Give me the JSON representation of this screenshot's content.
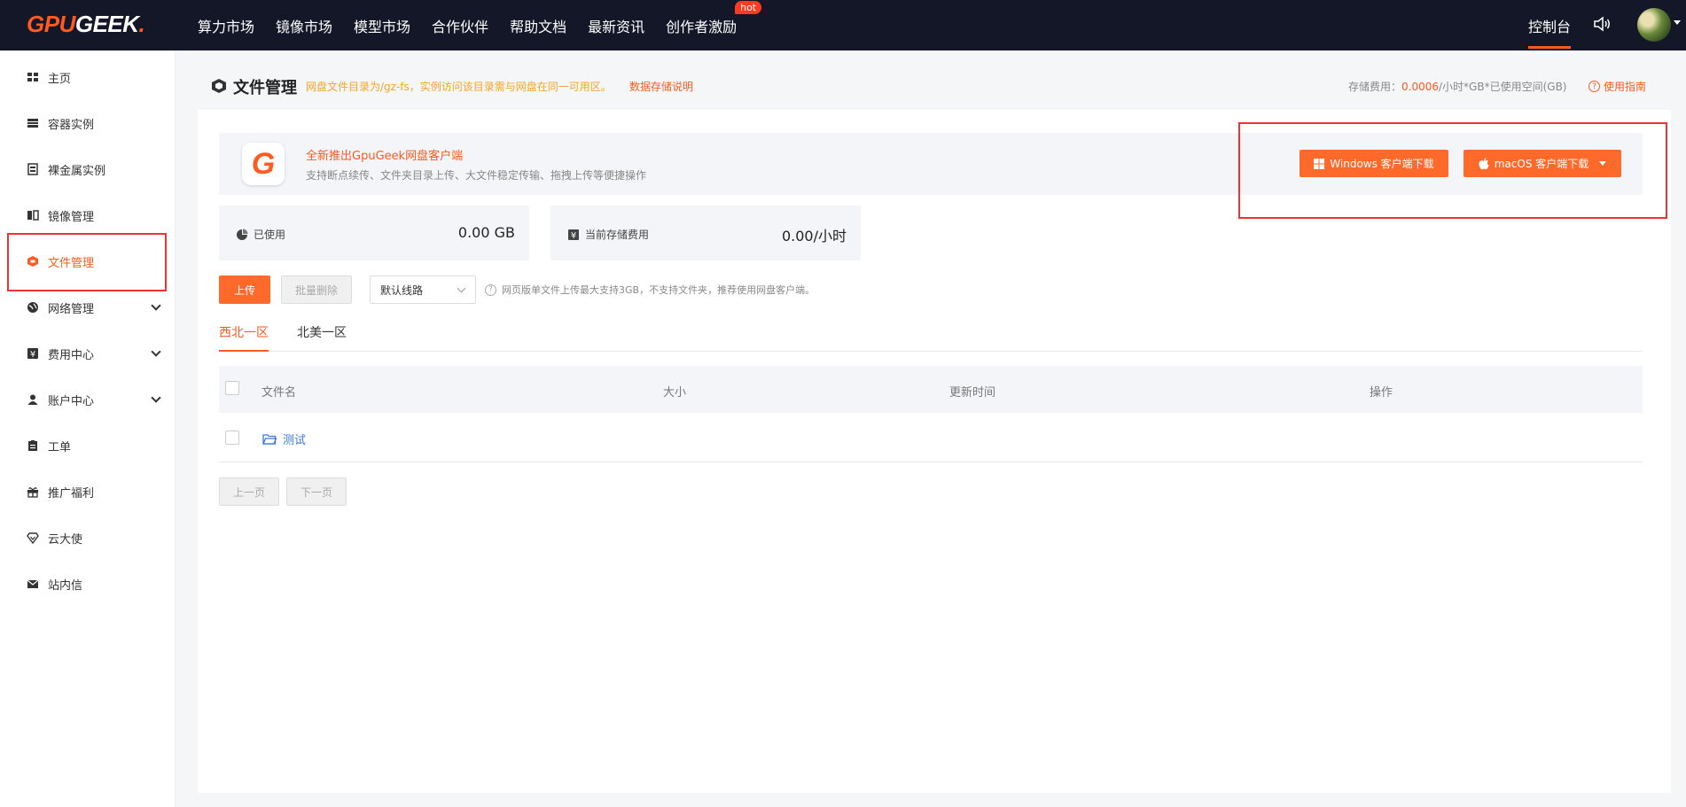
{
  "brand": {
    "part1": "GPU",
    "part2": "GEEK",
    "dot": "."
  },
  "nav": {
    "items": [
      "算力市场",
      "镜像市场",
      "模型市场",
      "合作伙伴",
      "帮助文档",
      "最新资讯",
      "创作者激励"
    ],
    "hot_badge": "hot",
    "console": "控制台"
  },
  "sidebar": {
    "items": [
      {
        "label": "主页",
        "icon": "grid-icon"
      },
      {
        "label": "容器实例",
        "icon": "server-icon"
      },
      {
        "label": "裸金属实例",
        "icon": "machine-icon"
      },
      {
        "label": "镜像管理",
        "icon": "image-icon"
      },
      {
        "label": "文件管理",
        "icon": "file-icon",
        "active": true
      },
      {
        "label": "网络管理",
        "icon": "globe-icon",
        "expandable": true
      },
      {
        "label": "费用中心",
        "icon": "yen-icon",
        "expandable": true
      },
      {
        "label": "账户中心",
        "icon": "user-icon",
        "expandable": true
      },
      {
        "label": "工单",
        "icon": "clipboard-icon"
      },
      {
        "label": "推广福利",
        "icon": "gift-icon"
      },
      {
        "label": "云大使",
        "icon": "diamond-icon"
      },
      {
        "label": "站内信",
        "icon": "mail-icon"
      }
    ]
  },
  "header": {
    "title": "文件管理",
    "subtitle": "网盘文件目录为/gz-fs，实例访问该目录需与网盘在同一可用区。",
    "doc_link": "数据存储说明",
    "cost_prefix": "存储费用：",
    "cost_value": "0.0006",
    "cost_suffix": "/小时*GB*已使用空间(GB)",
    "guide": "使用指南"
  },
  "banner": {
    "logo_letter": "G",
    "title": "全新推出GpuGeek网盘客户端",
    "subtitle": "支持断点续传、文件夹目录上传、大文件稳定传输、拖拽上传等便捷操作",
    "windows_button": "Windows 客户端下载",
    "mac_button": "macOS 客户端下载"
  },
  "stats": {
    "used_label": "已使用",
    "used_value": "0.00 GB",
    "fee_label": "当前存储费用",
    "fee_value": "0.00/小时"
  },
  "toolbar": {
    "upload": "上传",
    "batch_delete": "批量删除",
    "route_selected": "默认线路",
    "hint": "网页版单文件上传最大支持3GB，不支持文件夹，推荐使用网盘客户端。"
  },
  "tabs": [
    "西北一区",
    "北美一区"
  ],
  "table": {
    "columns": [
      "文件名",
      "大小",
      "更新时间",
      "操作"
    ],
    "rows": [
      {
        "name": "测试",
        "type": "folder"
      }
    ]
  },
  "pagination": {
    "prev": "上一页",
    "next": "下一页"
  },
  "colors": {
    "accent": "#ff5a1f",
    "nav_bg": "#141728",
    "link": "#3a7bd5"
  }
}
